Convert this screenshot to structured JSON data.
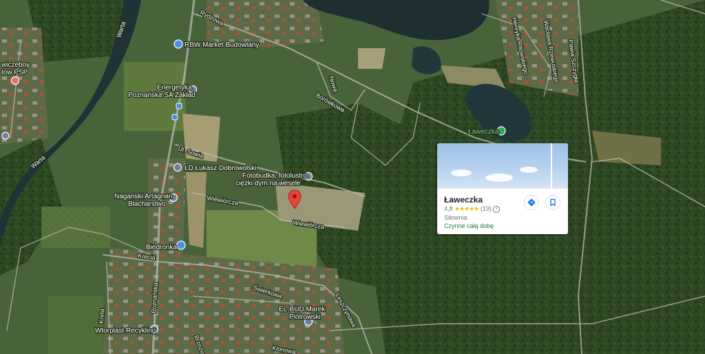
{
  "map": {
    "roads": {
      "rydzowa": "Rydzowa",
      "warta_north": "Warta",
      "warta_south": "Warta",
      "borowkowa": "Borówkowa",
      "sowia": "Ul. Sowia",
      "wiewiorcza_1": "Wiewiórcza",
      "wiewiorcza_2": "Wiewiórcza",
      "krecia": "Krecia",
      "kreta": "Kreta",
      "poznanska": "Poznańska",
      "swierkowa": "Świerkowa",
      "lesznowska": "Leszczynowa",
      "klonowa": "Klonowa",
      "brzozowa": "Brzozowa",
      "pawia_szczygla": "Pawia Szczygła",
      "henryka_ritowskiego": "Henryka Ritowskiego",
      "wacawa_rzewuskiego": "Wacława Rzewuskiego",
      "nowa": "Nowa"
    },
    "pois": {
      "rbw": "RBW Market Budowlany",
      "energetyka": [
        "Energetyka",
        "Poznańska SA Zakład"
      ],
      "ld_lukasz": "ŁD Łukasz Dobrowolski",
      "fotobudka": [
        "Fotobudka, fotolustro",
        "ciężki dym na wesele"
      ],
      "naganski": [
        "Nagański Artagnan",
        "Blacharstwo"
      ],
      "biedronka": "Biedronka",
      "el_bud": [
        "EL-BUD Marek",
        "Piotrowski"
      ],
      "wtorplast": "Wtorplast Recykling",
      "left_edge": [
        "wiczeboy",
        "tow PSP"
      ],
      "laweczka": "Ławeczka"
    },
    "colors": {
      "marker_red": "#ea4335",
      "poi_blue": "#4e8ee9",
      "poi_green": "#34a853",
      "forest": "#2f4a23",
      "river": "#1f3336"
    },
    "icons": {
      "selected_marker": "red-pin-icon",
      "poi": "map-poi-icon",
      "park": "green-park-pin-icon",
      "bus": "bus-stop-icon",
      "shop": "shopping-icon"
    }
  },
  "place_card": {
    "name": "Ławeczka",
    "rating": "4,8",
    "stars": "★★★★★",
    "review_count": "(19)",
    "info_icon": "i",
    "category": "Siłownia",
    "hours": "Czynne całą dobę",
    "directions_icon": "directions-icon",
    "save_icon": "bookmark-icon"
  }
}
